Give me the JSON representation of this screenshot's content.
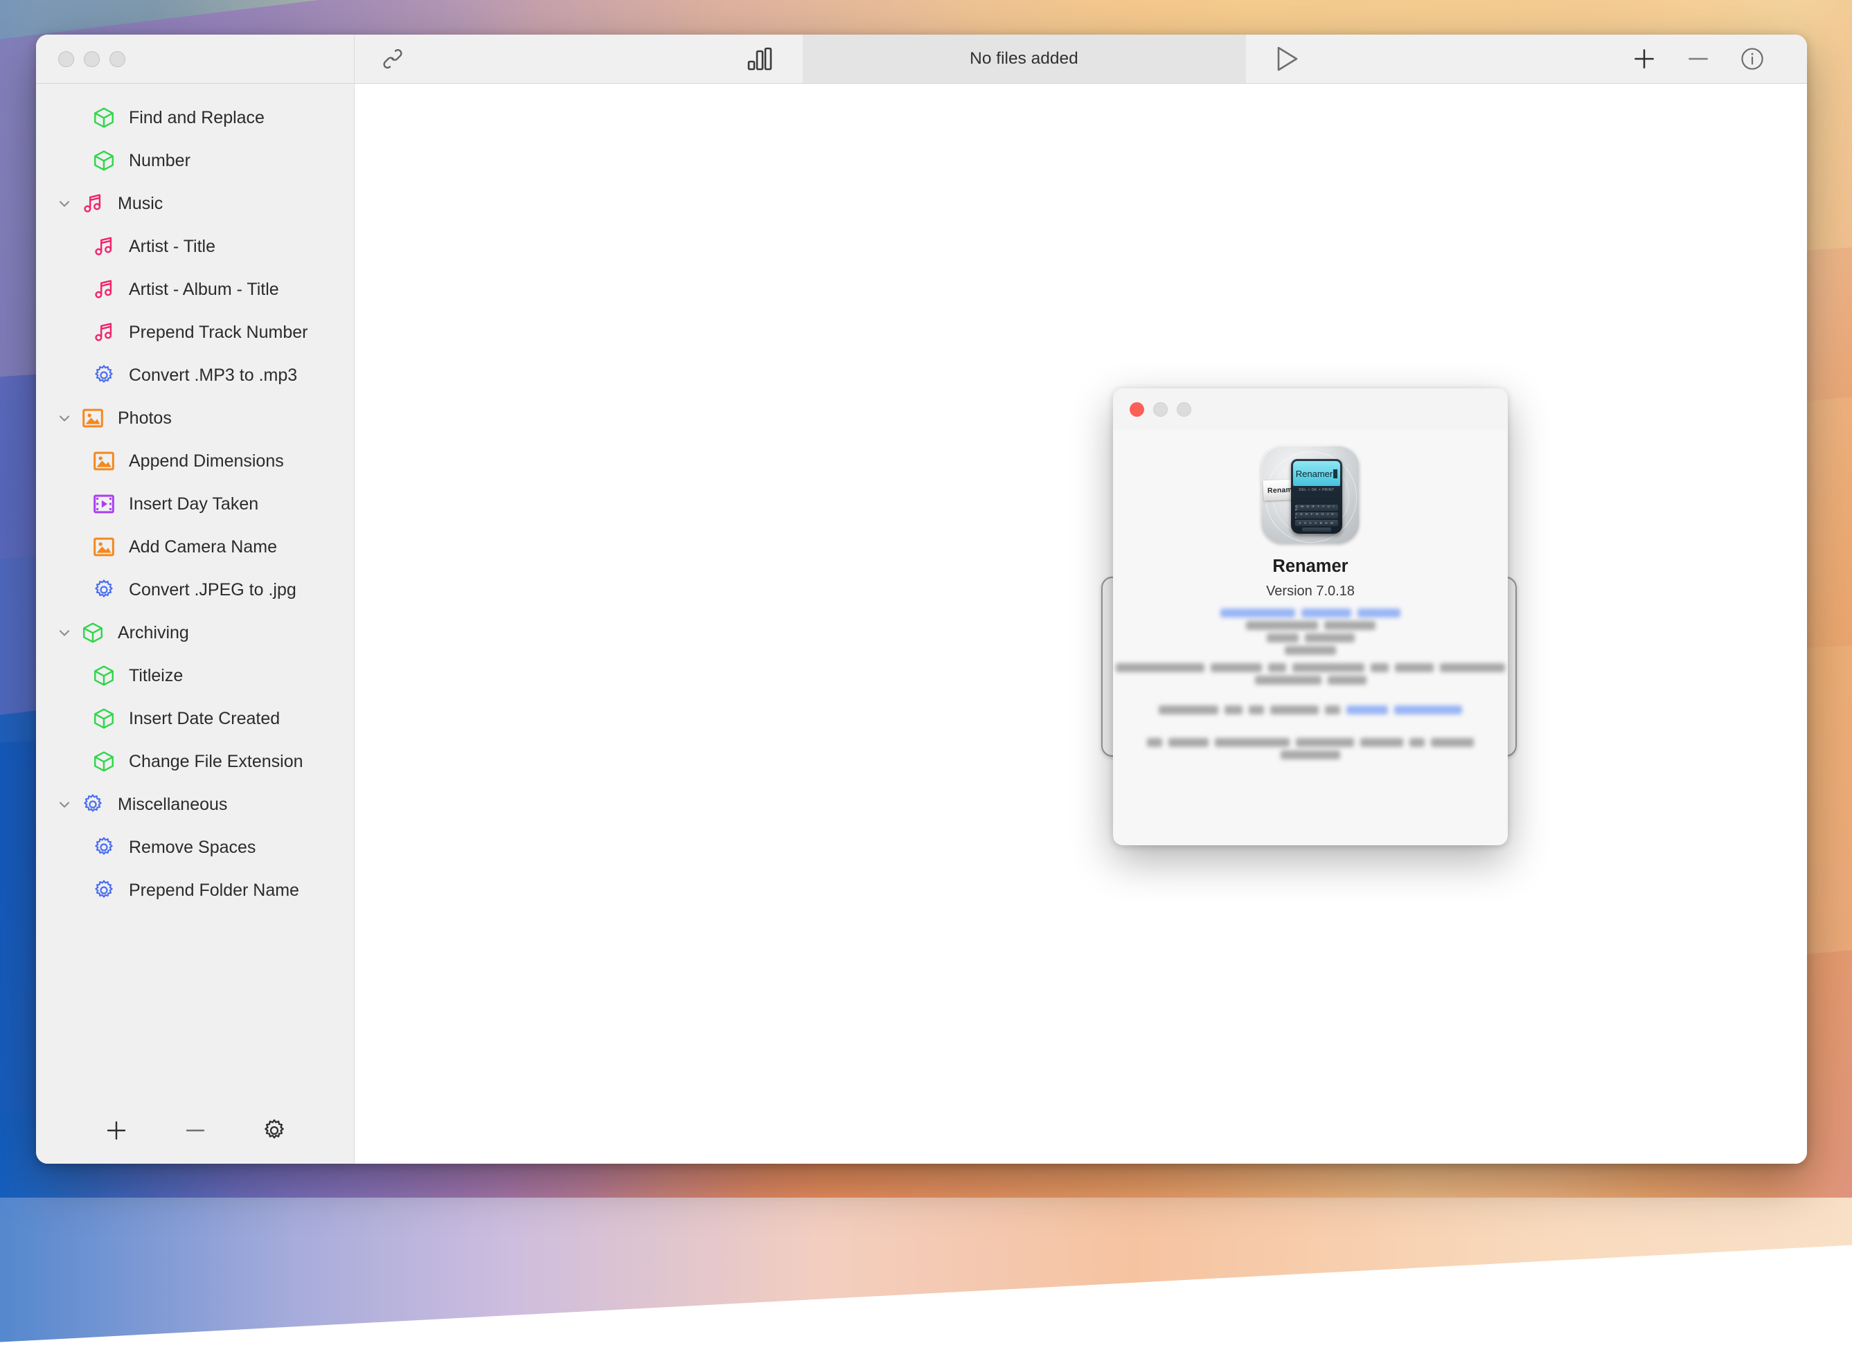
{
  "window": {
    "traffic_lights": [
      "close",
      "minimize",
      "maximize"
    ]
  },
  "toolbar": {
    "link_icon": "link-icon",
    "stats_icon": "bar-chart-icon",
    "status_text": "No files added",
    "play_icon": "play-triangle-icon",
    "add_icon": "plus-icon",
    "remove_icon": "minus-icon",
    "info_icon": "info-circle-icon"
  },
  "sidebar": {
    "items": [
      {
        "label": "Find and Replace",
        "icon": "cube-icon",
        "level": 1,
        "expandable": false
      },
      {
        "label": "Number",
        "icon": "cube-icon",
        "level": 1,
        "expandable": false
      },
      {
        "label": "Music",
        "icon": "music-icon",
        "level": 0,
        "expandable": true
      },
      {
        "label": "Artist - Title",
        "icon": "music-icon",
        "level": 1,
        "expandable": false
      },
      {
        "label": "Artist - Album - Title",
        "icon": "music-icon",
        "level": 1,
        "expandable": false
      },
      {
        "label": "Prepend Track Number",
        "icon": "music-icon",
        "level": 1,
        "expandable": false
      },
      {
        "label": "Convert .MP3 to .mp3",
        "icon": "gear-icon",
        "level": 1,
        "expandable": false
      },
      {
        "label": "Photos",
        "icon": "photo-icon",
        "level": 0,
        "expandable": true
      },
      {
        "label": "Append Dimensions",
        "icon": "photo-icon",
        "level": 1,
        "expandable": false
      },
      {
        "label": "Insert Day Taken",
        "icon": "film-icon",
        "level": 1,
        "expandable": false
      },
      {
        "label": "Add Camera Name",
        "icon": "photo-icon",
        "level": 1,
        "expandable": false
      },
      {
        "label": "Convert .JPEG to .jpg",
        "icon": "gear-icon",
        "level": 1,
        "expandable": false
      },
      {
        "label": "Archiving",
        "icon": "cube-icon",
        "level": 0,
        "expandable": true
      },
      {
        "label": "Titleize",
        "icon": "cube-icon",
        "level": 1,
        "expandable": false
      },
      {
        "label": "Insert Date Created",
        "icon": "cube-icon",
        "level": 1,
        "expandable": false
      },
      {
        "label": "Change File Extension",
        "icon": "cube-icon",
        "level": 1,
        "expandable": false
      },
      {
        "label": "Miscellaneous",
        "icon": "gear-icon",
        "level": 0,
        "expandable": true
      },
      {
        "label": "Remove Spaces",
        "icon": "gear-icon",
        "level": 1,
        "expandable": false
      },
      {
        "label": "Prepend Folder Name",
        "icon": "gear-icon",
        "level": 1,
        "expandable": false
      }
    ],
    "footer": {
      "add_icon": "plus-icon",
      "remove_icon": "minus-icon",
      "settings_icon": "gear-icon"
    }
  },
  "about_dialog": {
    "traffic_lights": [
      "close",
      "minimize",
      "maximize"
    ],
    "icon_name": "renamer-app-icon",
    "icon_screen_text": "Renamer",
    "icon_tape_text": "Renam",
    "icon_nav_keys": "DEL  <  OK  >  PRINT",
    "icon_key_rows": [
      "Q W E R T Y U I P",
      "A S D F G H J K L",
      "Z X C V B N M"
    ],
    "app_name": "Renamer",
    "version": "Version 7.0.18",
    "redacted_note": "remaining credits text is blurred/redacted in the screenshot"
  },
  "colors": {
    "sidebar_bg": "#f0f0f0",
    "content_bg": "#ffffff",
    "status_segment_bg": "#e4e4e4",
    "icon_green": "#2fd64a",
    "icon_pink": "#f2226b",
    "icon_orange": "#f5881f",
    "icon_purple": "#a93ef5",
    "icon_blue": "#4a6ef0",
    "close_red": "#fc5f57",
    "link_blue": "#7ea2f5"
  }
}
